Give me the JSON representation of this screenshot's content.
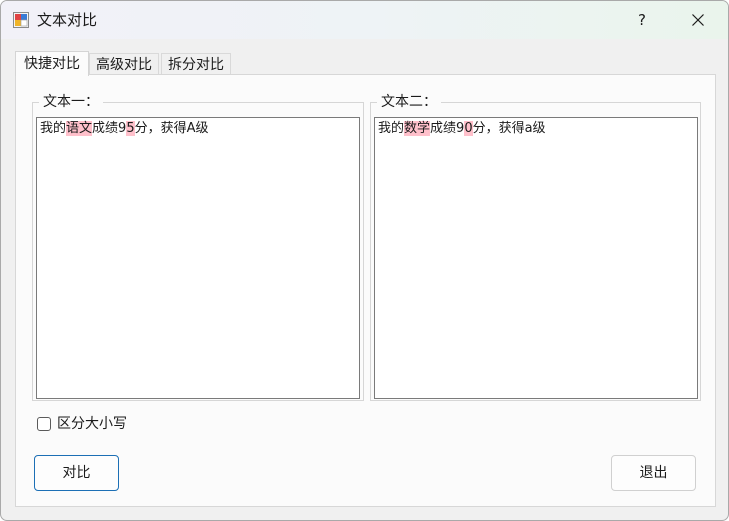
{
  "window": {
    "title": "文本对比",
    "help_label": "?"
  },
  "tabs": [
    {
      "label": "快捷对比",
      "active": true
    },
    {
      "label": "高级对比",
      "active": false
    },
    {
      "label": "拆分对比",
      "active": false
    }
  ],
  "text1": {
    "legend": "文本一：",
    "segments": [
      {
        "text": "我的",
        "diff": false
      },
      {
        "text": "语文",
        "diff": true
      },
      {
        "text": "成绩9",
        "diff": false
      },
      {
        "text": "5",
        "diff": true
      },
      {
        "text": "分，获得A级",
        "diff": false
      }
    ]
  },
  "text2": {
    "legend": "文本二：",
    "segments": [
      {
        "text": "我的",
        "diff": false
      },
      {
        "text": "数学",
        "diff": true
      },
      {
        "text": "成绩9",
        "diff": false
      },
      {
        "text": "0",
        "diff": true
      },
      {
        "text": "分，获得a级",
        "diff": false
      }
    ]
  },
  "case_sensitive": {
    "label": "区分大小写",
    "checked": false
  },
  "buttons": {
    "compare": "对比",
    "exit": "退出"
  },
  "colors": {
    "diff_highlight": "#ffc0cb",
    "primary_border": "#1c6fb5"
  }
}
